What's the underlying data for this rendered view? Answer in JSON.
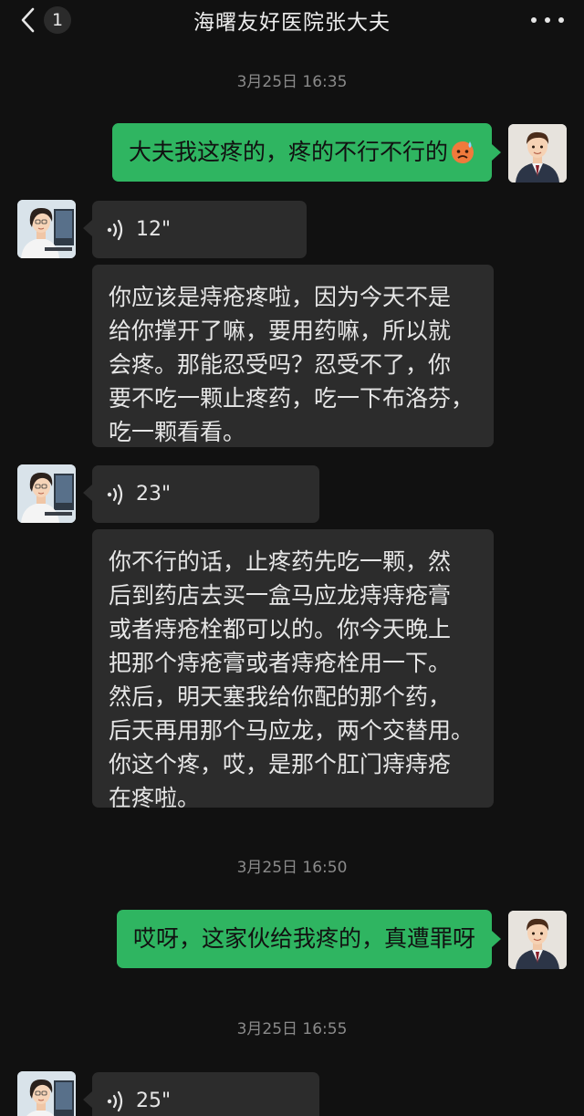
{
  "header": {
    "title": "海曙友好医院张大夫",
    "unread_count": "1",
    "back_icon": "chevron-left-icon",
    "more_icon": "more-dots-icon"
  },
  "messages": [
    {
      "kind": "timestamp",
      "text": "3月25日 16:35"
    },
    {
      "kind": "text",
      "side": "out",
      "text": "大夫我这疼的，疼的不行不行的",
      "emoji": "sweating-face-emoji"
    },
    {
      "kind": "voice",
      "side": "in",
      "duration": "12\""
    },
    {
      "kind": "transcript",
      "side": "in",
      "lines": [
        "你应该是痔疮疼啦，因为今天不是",
        "给你撑开了嘛，要用药嘛，所以就",
        "会疼。那能忍受吗？忍受不了，你",
        "要不吃一颗止疼药，吃一下布洛芬，",
        "吃一颗看看。"
      ]
    },
    {
      "kind": "voice",
      "side": "in",
      "duration": "23\""
    },
    {
      "kind": "transcript",
      "side": "in",
      "lines": [
        "你不行的话，止疼药先吃一颗，然",
        "后到药店去买一盒马应龙痔痔疮膏",
        "或者痔疮栓都可以的。你今天晚上",
        "把那个痔疮膏或者痔疮栓用一下。",
        "然后，明天塞我给你配的那个药，",
        "后天再用那个马应龙，两个交替用。",
        "你这个疼，哎，是那个肛门痔痔疮",
        "在疼啦。"
      ]
    },
    {
      "kind": "timestamp",
      "text": "3月25日 16:50"
    },
    {
      "kind": "text",
      "side": "out",
      "text": "哎呀，这家伙给我疼的，真遭罪呀"
    },
    {
      "kind": "timestamp",
      "text": "3月25日 16:55"
    },
    {
      "kind": "voice",
      "side": "in",
      "duration": "25\""
    }
  ],
  "colors": {
    "background": "#111111",
    "outgoing_bubble": "#2fb561",
    "incoming_bubble": "#2c2c2c",
    "timestamp_text": "#8a8a8a"
  },
  "avatars": {
    "self": "male-avatar-suit",
    "doctor": "female-doctor-avatar"
  }
}
